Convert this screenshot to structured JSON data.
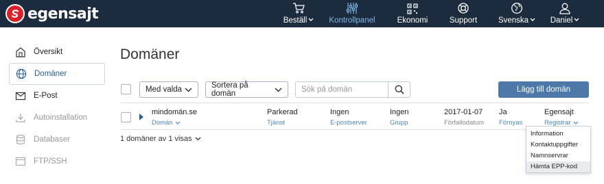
{
  "brand": {
    "name": "egensajt"
  },
  "nav": [
    {
      "label": "Beställ",
      "icon": "cart-icon",
      "dropdown": true,
      "active": false
    },
    {
      "label": "Kontrollpanel",
      "icon": "sliders-icon",
      "dropdown": false,
      "active": true
    },
    {
      "label": "Ekonomi",
      "icon": "qr-icon",
      "dropdown": false,
      "active": false
    },
    {
      "label": "Support",
      "icon": "lifebuoy-icon",
      "dropdown": false,
      "active": false
    },
    {
      "label": "Svenska",
      "icon": "globe-icon",
      "dropdown": true,
      "active": false
    },
    {
      "label": "Daniel",
      "icon": "user-icon",
      "dropdown": true,
      "active": false
    }
  ],
  "sidebar": [
    {
      "label": "Översikt",
      "icon": "home-icon",
      "state": "normal"
    },
    {
      "label": "Domäner",
      "icon": "globe-icon",
      "state": "active"
    },
    {
      "label": "E-Post",
      "icon": "envelope-icon",
      "state": "normal"
    },
    {
      "label": "Autoinstallation",
      "icon": "download-icon",
      "state": "disabled"
    },
    {
      "label": "Databaser",
      "icon": "database-icon",
      "state": "disabled"
    },
    {
      "label": "FTP/SSH",
      "icon": "terminal-icon",
      "state": "disabled"
    }
  ],
  "main": {
    "title": "Domäner",
    "selected_label": "Med valda",
    "sort_label": "Sortera på domän",
    "search_placeholder": "Sök på domän",
    "add_button": "Lägg till domän",
    "count_text": "1 domäner av 1 visas"
  },
  "domain_row": {
    "domain": "mindomän.se",
    "domain_link": "Domän",
    "service_value": "Parkerad",
    "service_label": "Tjänst",
    "email_value": "Ingen",
    "email_label": "E-postserver",
    "group_value": "Ingen",
    "group_label": "Grupp",
    "expiry_value": "2017-01-07",
    "expiry_label": "Förfallodatum",
    "renew_value": "Ja",
    "renew_label": "Förnyas",
    "registrar_value": "Egensajt",
    "registrar_label": "Registrar"
  },
  "registrar_menu": [
    {
      "label": "Information",
      "hover": false
    },
    {
      "label": "Kontaktuppgifter",
      "hover": false
    },
    {
      "label": "Namnservrar",
      "hover": false
    },
    {
      "label": "Hämta EPP-kod",
      "hover": true
    }
  ],
  "colors": {
    "topbar": "#1c2b3d",
    "accent": "#4c79a8",
    "link": "#4c86c6",
    "active_nav": "#7fb7e6",
    "logo_red": "#d8222a"
  }
}
